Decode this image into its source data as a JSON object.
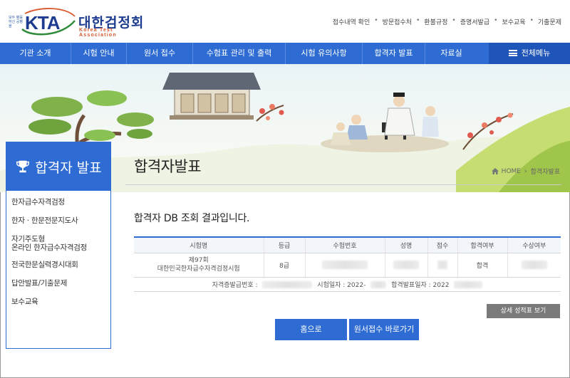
{
  "header": {
    "logo_side_text": "모두 평등하신 공평을",
    "logo_kta": "KTA",
    "logo_korean": "대한검정회",
    "logo_english": "Korea Test Association",
    "utility_links": [
      "접수내역 확인",
      "방문접수처",
      "환불규정",
      "증명서발급",
      "보수교육",
      "기출문제"
    ]
  },
  "nav": {
    "items": [
      "기관 소개",
      "시험 안내",
      "원서 접수",
      "수험표 관리 및 출력",
      "시험 유의사항",
      "합격자 발표",
      "자료실"
    ],
    "all_menu": "전체메뉴"
  },
  "sidebar": {
    "title": "합격자 발표",
    "items": [
      "한자급수자격검정",
      "한자 · 한문전문지도사",
      "자기주도형\n온라인 한자급수자격검정",
      "전국한문실력경시대회",
      "답안발표/기출문제",
      "보수교육"
    ]
  },
  "main": {
    "title": "합격자발표",
    "breadcrumb_home": "HOME",
    "breadcrumb_current": "합격자발표",
    "result_message": "합격자 DB 조회 결과입니다."
  },
  "table": {
    "headers": [
      "시험명",
      "등급",
      "수험번호",
      "성명",
      "점수",
      "합격여부",
      "수상여부"
    ],
    "row": {
      "exam_name": "제97회\n대한민국한자급수자격검정시험",
      "grade": "8급",
      "pass_status": "합격"
    },
    "footer": {
      "cert_label": "자격증발급번호 :",
      "exam_date_label": "시험일자 : 2022-",
      "announce_date_label": "합격발표일자 : 2022"
    }
  },
  "buttons": {
    "detail": "상세 성적표 보기",
    "home": "홈으로",
    "apply": "원서접수 바로가기"
  },
  "colors": {
    "primary": "#2e6cd3",
    "primary_dark": "#1f55b8",
    "detail_button": "#7a7a7a"
  }
}
